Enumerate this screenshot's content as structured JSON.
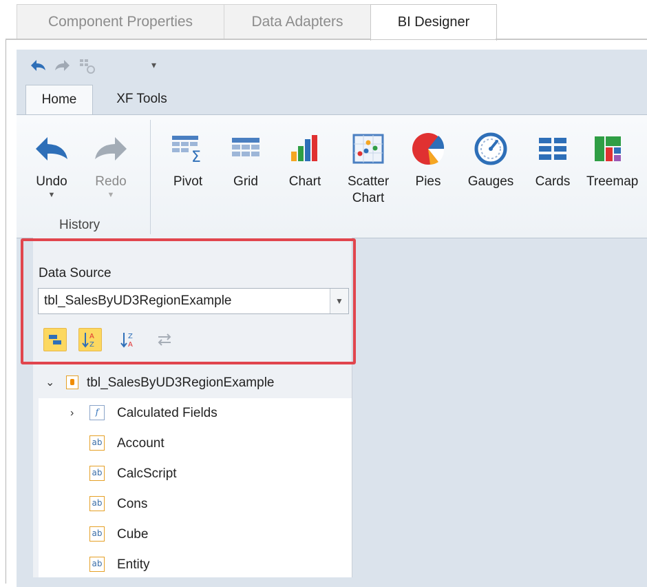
{
  "top_tabs": [
    {
      "label": "Component Properties",
      "active": false
    },
    {
      "label": "Data Adapters",
      "active": false
    },
    {
      "label": "BI Designer",
      "active": true
    }
  ],
  "ribbon_tabs": [
    {
      "label": "Home",
      "active": true
    },
    {
      "label": "XF Tools",
      "active": false
    }
  ],
  "history_group": {
    "label": "History",
    "undo": "Undo",
    "redo": "Redo"
  },
  "insert_buttons": [
    "Pivot",
    "Grid",
    "Chart",
    "Scatter Chart",
    "Pies",
    "Gauges",
    "Cards",
    "Treemap"
  ],
  "data_source": {
    "label": "Data Source",
    "value": "tbl_SalesByUD3RegionExample"
  },
  "tree": {
    "root": "tbl_SalesByUD3RegionExample",
    "calculated": "Calculated Fields",
    "fields": [
      "Account",
      "CalcScript",
      "Cons",
      "Cube",
      "Entity"
    ],
    "field_icon_text": "ab",
    "calc_icon_text": "f"
  },
  "colors": {
    "accent_highlight": "#e1454d",
    "selected_toggle": "#fcd860"
  }
}
